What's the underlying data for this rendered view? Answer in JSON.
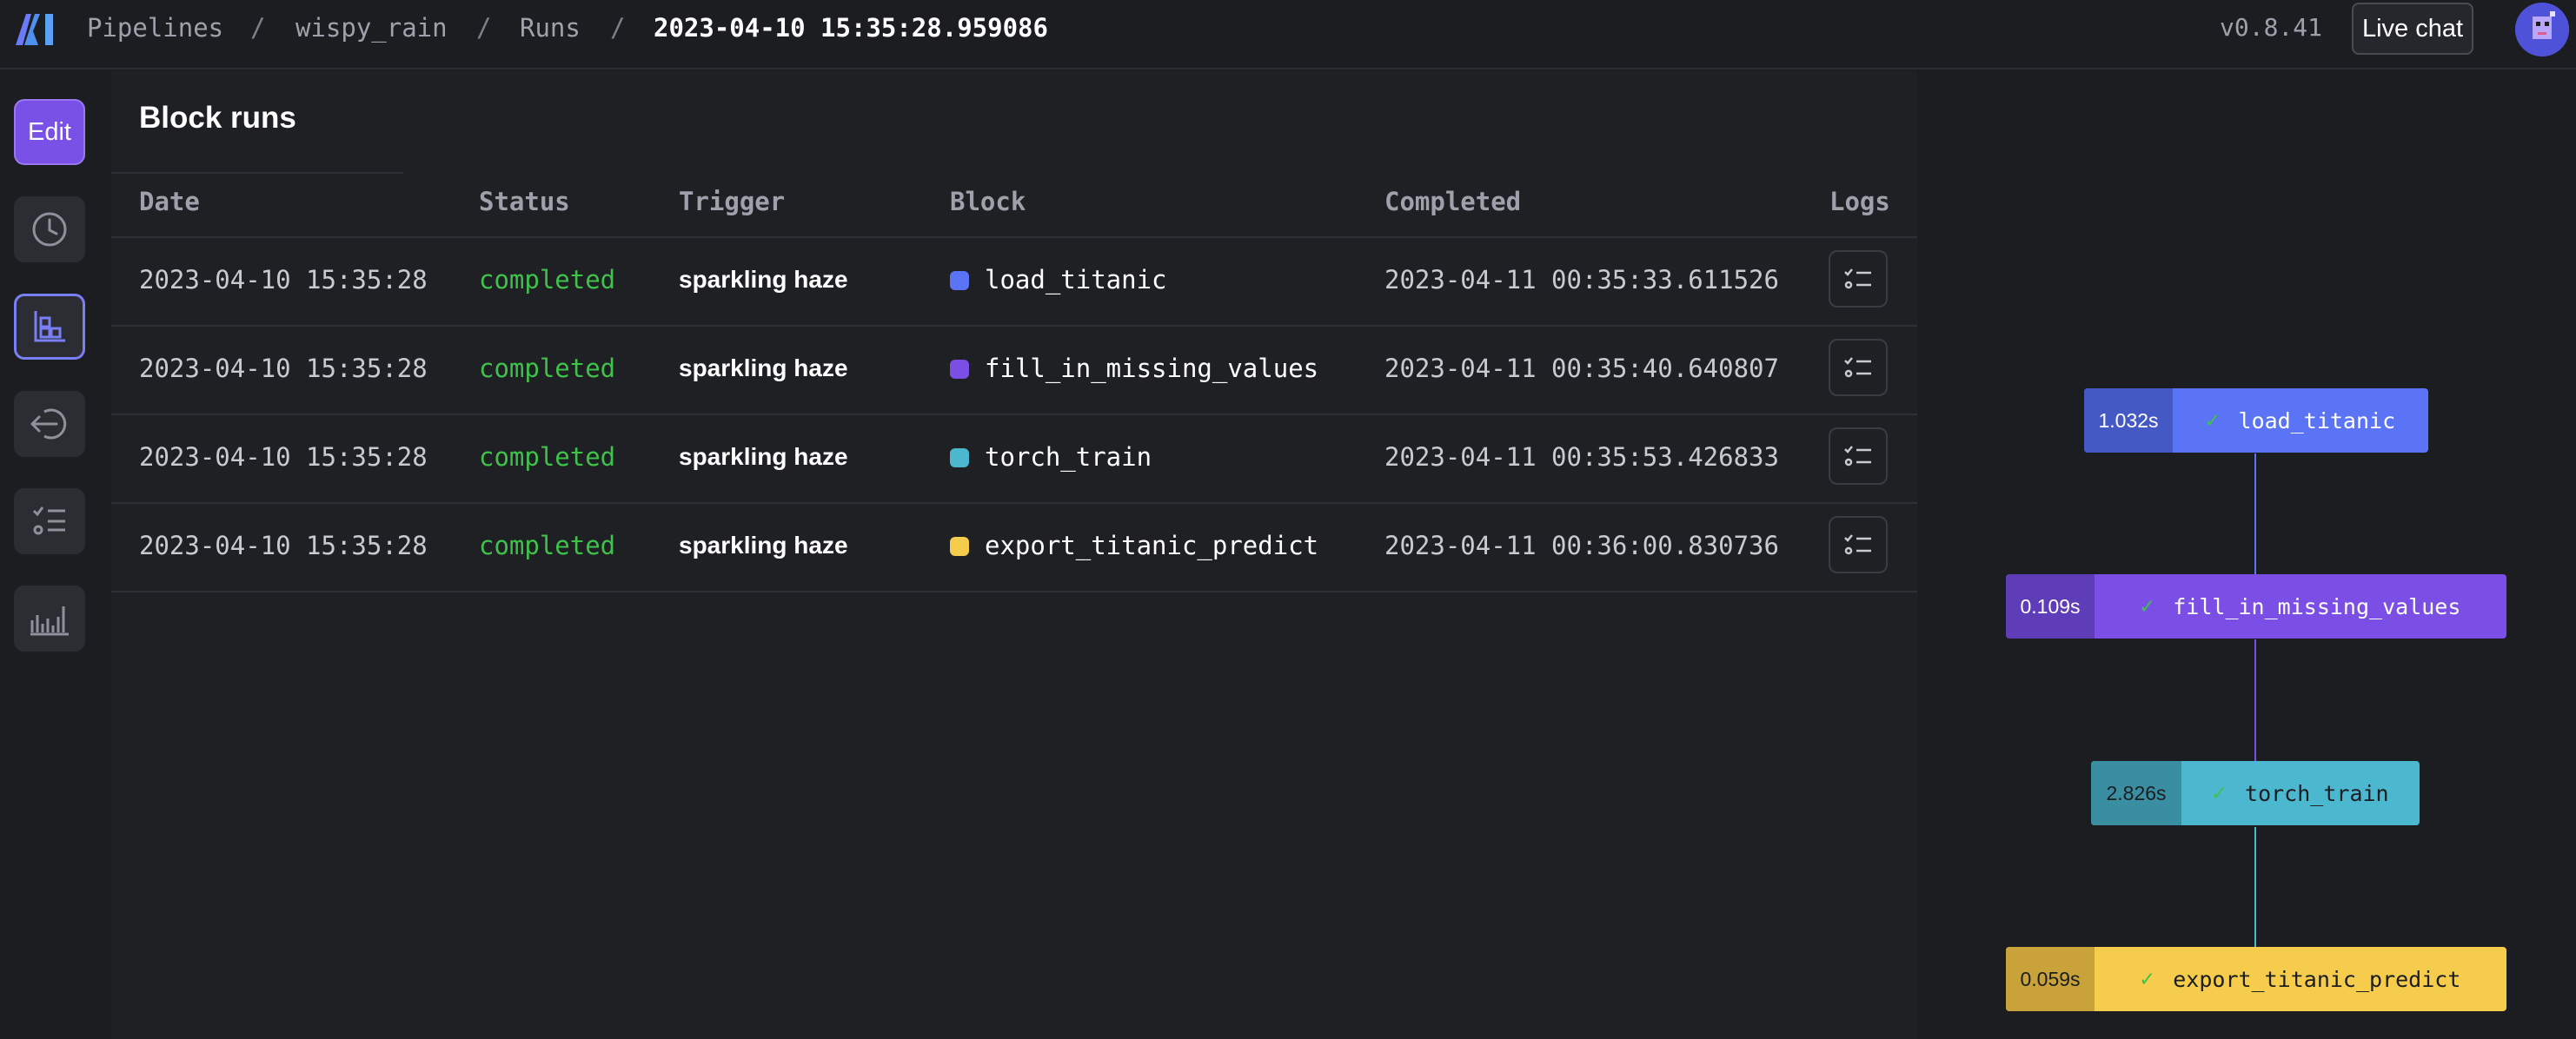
{
  "header": {
    "breadcrumb": [
      "Pipelines",
      "wispy_rain",
      "Runs",
      "2023-04-10 15:35:28.959086"
    ],
    "separator": "/",
    "version": "v0.8.41",
    "live_chat_label": "Live chat"
  },
  "sidebar": {
    "edit_label": "Edit",
    "items": [
      {
        "icon": "clock-icon"
      },
      {
        "icon": "blocks-icon",
        "active": true
      },
      {
        "icon": "trigger-icon"
      },
      {
        "icon": "checklist-icon"
      },
      {
        "icon": "bar-chart-icon"
      }
    ]
  },
  "main": {
    "title": "Block runs",
    "columns": [
      "Date",
      "Status",
      "Trigger",
      "Block",
      "Completed",
      "Logs"
    ],
    "rows": [
      {
        "date": "2023-04-10 15:35:28",
        "status": "completed",
        "trigger": "sparkling haze",
        "block": "load_titanic",
        "block_color": "#5a74f5",
        "completed": "2023-04-11 00:35:33.611526"
      },
      {
        "date": "2023-04-10 15:35:28",
        "status": "completed",
        "trigger": "sparkling haze",
        "block": "fill_in_missing_values",
        "block_color": "#7b4fe6",
        "completed": "2023-04-11 00:35:40.640807"
      },
      {
        "date": "2023-04-10 15:35:28",
        "status": "completed",
        "trigger": "sparkling haze",
        "block": "torch_train",
        "block_color": "#4cb8d0",
        "completed": "2023-04-11 00:35:53.426833"
      },
      {
        "date": "2023-04-10 15:35:28",
        "status": "completed",
        "trigger": "sparkling haze",
        "block": "export_titanic_predict",
        "block_color": "#f6cc4c",
        "completed": "2023-04-11 00:36:00.830736"
      }
    ]
  },
  "graph": {
    "nodes": [
      {
        "time": "1.032s",
        "label": "load_titanic"
      },
      {
        "time": "0.109s",
        "label": "fill_in_missing_values"
      },
      {
        "time": "2.826s",
        "label": "torch_train"
      },
      {
        "time": "0.059s",
        "label": "export_titanic_predict"
      }
    ]
  }
}
